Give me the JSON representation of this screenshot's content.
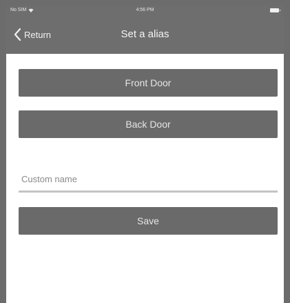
{
  "status_bar": {
    "carrier": "No SIM",
    "time": "4:56 PM",
    "wifi_icon": "wifi-icon",
    "battery_icon": "battery-icon"
  },
  "nav": {
    "back_label": "Return",
    "back_icon": "chevron-left-icon",
    "title": "Set a alias"
  },
  "buttons": {
    "front_door": "Front Door",
    "back_door": "Back Door",
    "save": "Save"
  },
  "custom_name": {
    "placeholder": "Custom name",
    "value": ""
  },
  "colors": {
    "nav_background": "#6e6e6e",
    "button_background": "#6a6a6a",
    "screen_background": "#ffffff",
    "input_underline": "#c4c4c4"
  }
}
